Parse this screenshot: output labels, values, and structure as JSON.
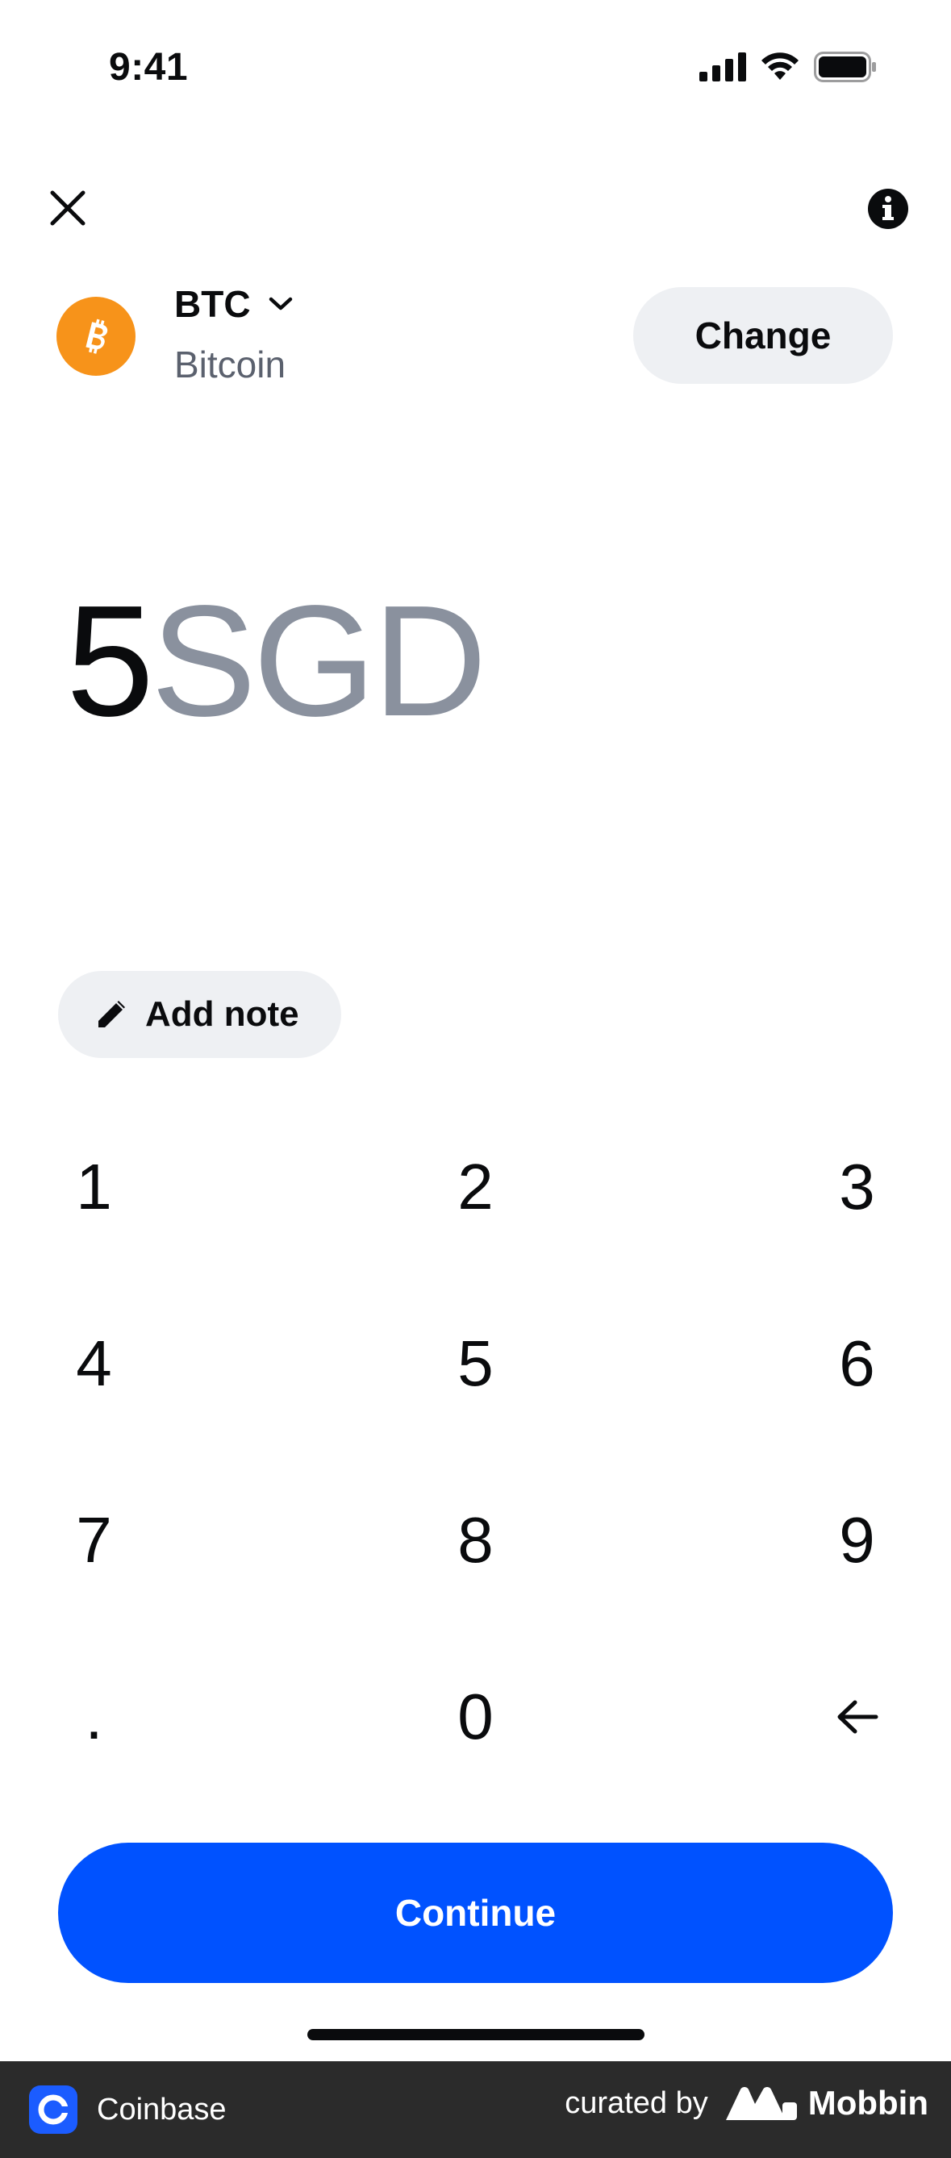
{
  "status_bar": {
    "time": "9:41"
  },
  "nav": {
    "close_icon": "close-icon",
    "info_icon": "info-icon"
  },
  "asset": {
    "symbol": "BTC",
    "name": "Bitcoin",
    "icon": "bitcoin-icon",
    "icon_color": "#F7931A",
    "change_label": "Change"
  },
  "amount": {
    "value": "5",
    "currency": "SGD"
  },
  "note": {
    "label": "Add note",
    "icon": "pencil-icon"
  },
  "keypad": {
    "keys": [
      "1",
      "2",
      "3",
      "4",
      "5",
      "6",
      "7",
      "8",
      "9",
      ".",
      "0"
    ],
    "backspace_icon": "backspace-arrow-icon"
  },
  "continue_label": "Continue",
  "colors": {
    "primary": "#0052FF",
    "muted_text": "#5B616E",
    "currency_text": "#8A919E",
    "pill_bg": "#EEF0F3"
  },
  "footer": {
    "app_name": "Coinbase",
    "curated_by": "curated by",
    "brand": "Mobbin"
  }
}
